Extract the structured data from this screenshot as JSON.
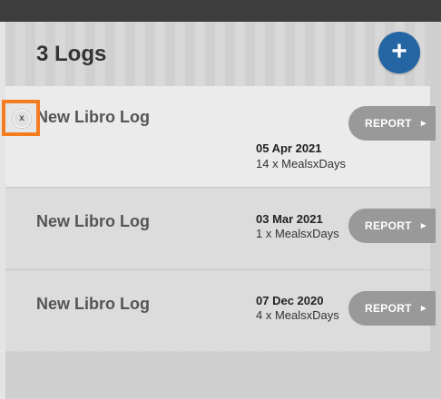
{
  "header": {
    "title": "3 Logs",
    "add_label": "+"
  },
  "logs": [
    {
      "name": "New Libro Log",
      "date": "05 Apr 2021",
      "count": "14 x MealsxDays",
      "report_label": "REPORT",
      "report_arrow": "►",
      "close_label": "x"
    },
    {
      "name": "New Libro Log",
      "date": "03 Mar 2021",
      "count": "1 x MealsxDays",
      "report_label": "REPORT",
      "report_arrow": "►"
    },
    {
      "name": "New Libro Log",
      "date": "07 Dec 2020",
      "count": "4 x MealsxDays",
      "report_label": "REPORT",
      "report_arrow": "►"
    }
  ],
  "colors": {
    "accent": "#2465a3",
    "highlight": "#f47c20",
    "report_button": "#999999",
    "topbar": "#3d3d3d"
  }
}
